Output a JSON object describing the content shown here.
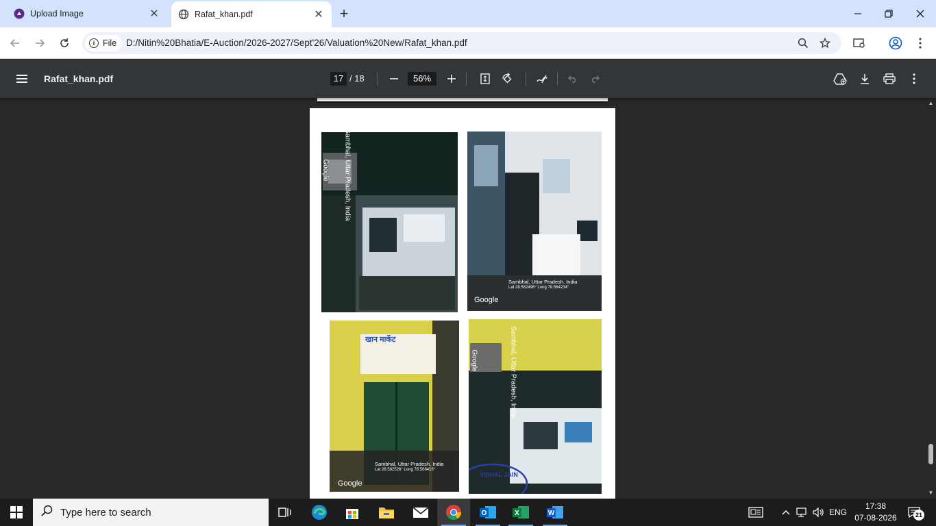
{
  "browser": {
    "tabs": [
      {
        "title": "Upload Image",
        "active": false,
        "icon": "upload-app-icon"
      },
      {
        "title": "Rafat_khan.pdf",
        "active": true,
        "icon": "globe-icon"
      }
    ],
    "scheme_chip": "File",
    "url": "D:/Nitin%20Bhatia/E-Auction/2026-2027/Sept'26/Valuation%20New/Rafat_khan.pdf"
  },
  "pdf": {
    "title": "Rafat_khan.pdf",
    "current_page": "17",
    "total_pages": "/ 18",
    "zoom": "56%"
  },
  "page_content": {
    "photo1": {
      "location": "Sambhal, Uttar Pradesh, India",
      "brand": "Google"
    },
    "photo2": {
      "location": "Sambhal, Uttar Pradesh, India",
      "brand": "Google",
      "coords": "Lat 28.582496° Long 78.564234°"
    },
    "photo3": {
      "sign_text": "खान मार्केट",
      "location": "Sambhal, Uttar Pradesh, India",
      "brand": "Google",
      "coords": "Lat 28.582526° Long 78.569416°"
    },
    "photo4": {
      "location": "Sambhal, Uttar Pradesh, India",
      "brand": "Google",
      "stamp": "VISHAL JAIN"
    }
  },
  "taskbar": {
    "search_placeholder": "Type here to search",
    "language": "ENG",
    "time": "17:38",
    "date": "07-08-2026",
    "notifications": "21"
  },
  "colors": {
    "tabstrip": "#d3e3fd",
    "pdf_toolbar": "#323639",
    "viewer_bg": "#282828",
    "taskbar": "#1c1c1c"
  }
}
